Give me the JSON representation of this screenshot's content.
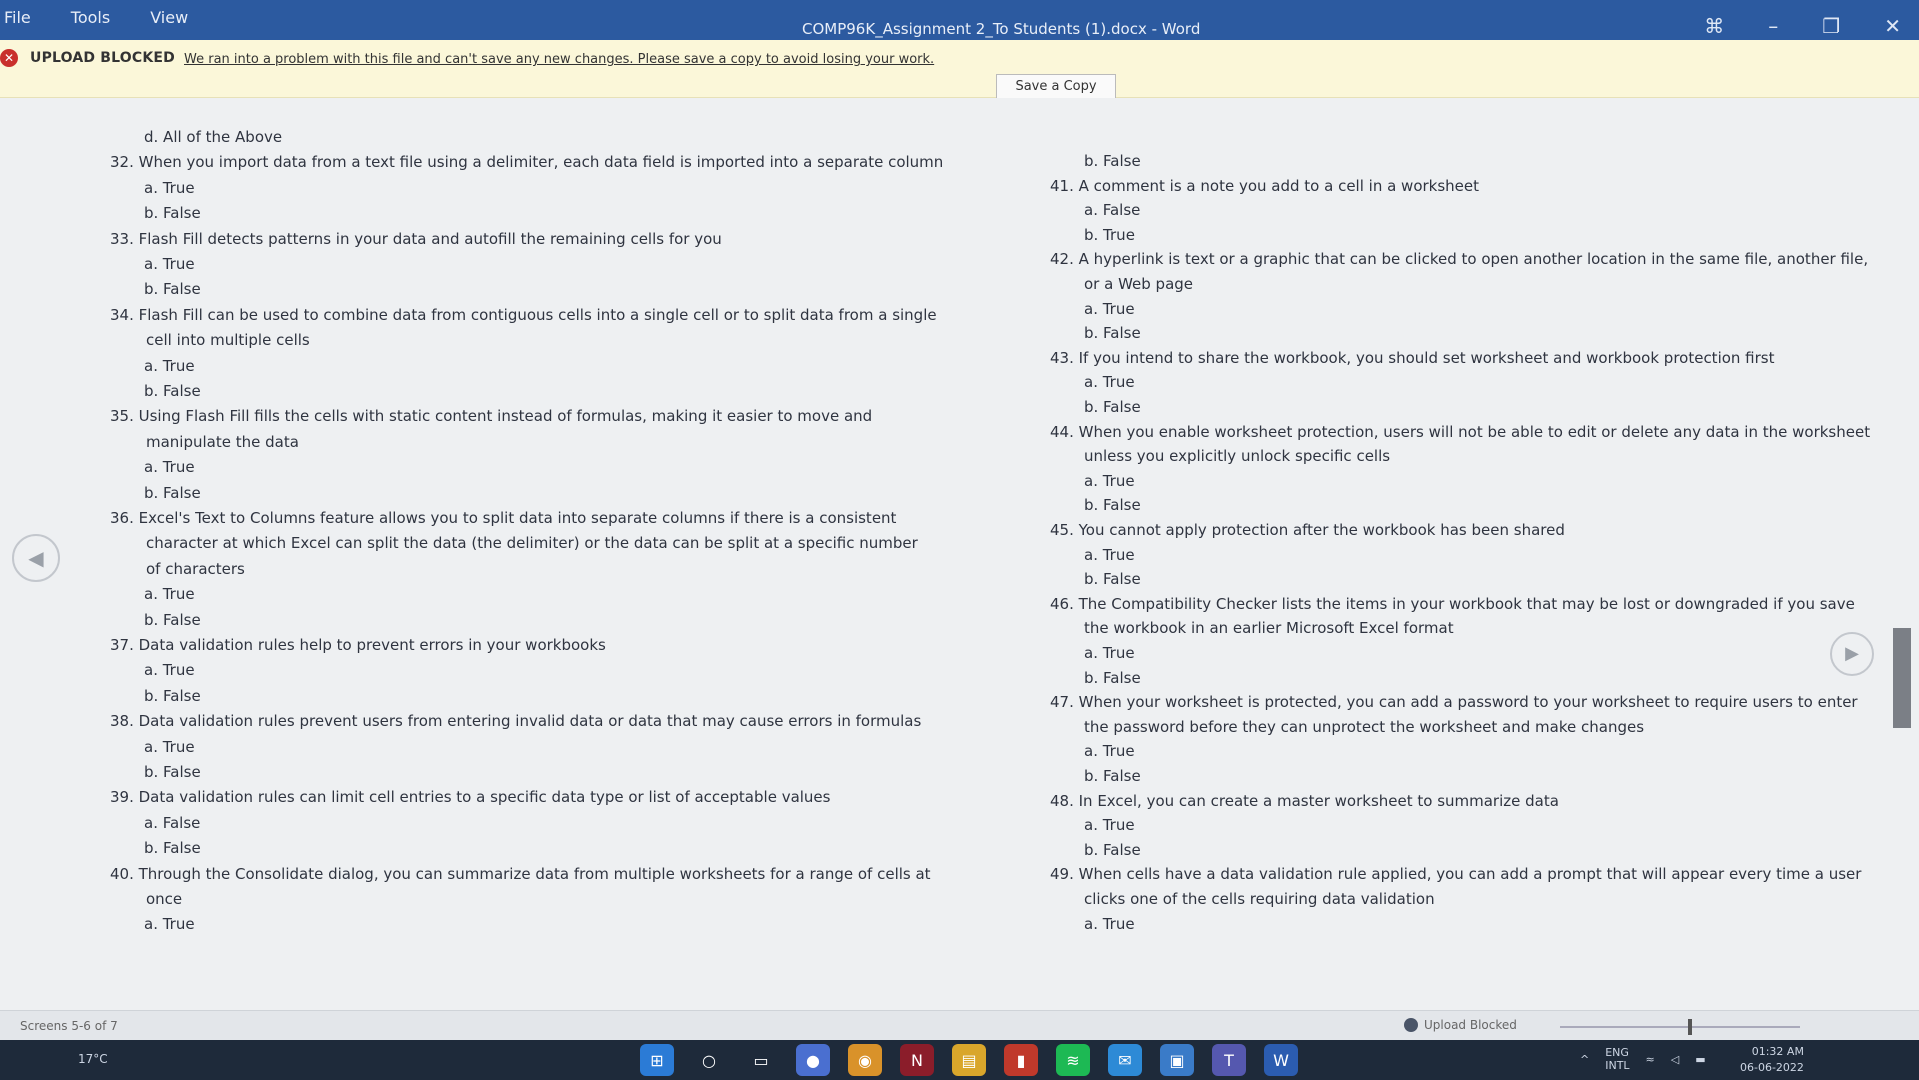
{
  "menu": [
    "File",
    "Tools",
    "View"
  ],
  "window": {
    "title": "COMP96K_Assignment 2_To Students (1).docx - Word"
  },
  "message_bar": {
    "title": "UPLOAD BLOCKED",
    "text": "We ran into a problem with this file and can't save any new changes. Please save a copy to avoid losing your work.",
    "button": "Save a Copy"
  },
  "left_column": [
    {
      "text": "d. All of the Above",
      "indent": 1
    },
    {
      "text": "32. When you import data from a text file using a delimiter, each data field is imported into a separate column",
      "indent": 0
    },
    {
      "text": "a. True",
      "indent": 1
    },
    {
      "text": "b. False",
      "indent": 1
    },
    {
      "text": "33. Flash Fill detects patterns in your data and autofill the remaining cells for you",
      "indent": 0
    },
    {
      "text": "a. True",
      "indent": 1
    },
    {
      "text": "b. False",
      "indent": 1
    },
    {
      "text": "34. Flash Fill can be used to combine data from contiguous cells into a single cell or to split data from a single",
      "indent": 0
    },
    {
      "text": "cell into multiple cells",
      "indent": 2
    },
    {
      "text": "a. True",
      "indent": 1
    },
    {
      "text": "b. False",
      "indent": 1
    },
    {
      "text": "35. Using Flash Fill fills the cells with static content instead of formulas, making it easier to move and",
      "indent": 0
    },
    {
      "text": "manipulate the data",
      "indent": 2
    },
    {
      "text": "a. True",
      "indent": 1
    },
    {
      "text": "b. False",
      "indent": 1
    },
    {
      "text": "36. Excel's Text to Columns feature allows you to split data into separate columns if there is a consistent",
      "indent": 0
    },
    {
      "text": "character at which Excel can split the data (the delimiter) or the data can be split at a specific number",
      "indent": 2
    },
    {
      "text": "of characters",
      "indent": 2
    },
    {
      "text": "a. True",
      "indent": 1
    },
    {
      "text": "b. False",
      "indent": 1
    },
    {
      "text": "37. Data validation rules help to prevent errors in your workbooks",
      "indent": 0
    },
    {
      "text": "a. True",
      "indent": 1
    },
    {
      "text": "b. False",
      "indent": 1
    },
    {
      "text": "38. Data validation rules prevent users from entering invalid data or data that may cause errors in formulas",
      "indent": 0
    },
    {
      "text": "a. True",
      "indent": 1
    },
    {
      "text": "b. False",
      "indent": 1
    },
    {
      "text": "39. Data validation rules can limit cell entries to a specific data type or list of acceptable values",
      "indent": 0
    },
    {
      "text": "a. False",
      "indent": 1
    },
    {
      "text": "b. False",
      "indent": 1
    },
    {
      "text": "40. Through the Consolidate dialog, you can summarize data from multiple worksheets for a range of cells at",
      "indent": 0
    },
    {
      "text": "once",
      "indent": 2
    },
    {
      "text": "a. True",
      "indent": 1
    }
  ],
  "right_column": [
    {
      "text": "b. False",
      "indent": 1
    },
    {
      "text": "41. A comment is a note you add to a cell in a worksheet",
      "indent": 0
    },
    {
      "text": "a. False",
      "indent": 1
    },
    {
      "text": "b. True",
      "indent": 1
    },
    {
      "text": "42. A hyperlink is text or a graphic that can be clicked to open another location in the same file, another file,",
      "indent": 0
    },
    {
      "text": "or a Web page",
      "indent": 2
    },
    {
      "text": "a. True",
      "indent": 1
    },
    {
      "text": "b. False",
      "indent": 1
    },
    {
      "text": "43. If you intend to share the workbook, you should set worksheet and workbook protection first",
      "indent": 0
    },
    {
      "text": "a. True",
      "indent": 1
    },
    {
      "text": "b. False",
      "indent": 1
    },
    {
      "text": "44. When you enable worksheet protection, users will not be able to edit or delete any data in the worksheet",
      "indent": 0
    },
    {
      "text": "unless you explicitly unlock specific cells",
      "indent": 2
    },
    {
      "text": "a. True",
      "indent": 1
    },
    {
      "text": "b. False",
      "indent": 1
    },
    {
      "text": "45. You cannot apply protection after the workbook has been shared",
      "indent": 0
    },
    {
      "text": "a. True",
      "indent": 1
    },
    {
      "text": "b. False",
      "indent": 1
    },
    {
      "text": "46. The Compatibility Checker lists the items in your workbook that may be lost or downgraded if you save",
      "indent": 0
    },
    {
      "text": "the workbook in an earlier Microsoft Excel format",
      "indent": 2
    },
    {
      "text": "a. True",
      "indent": 1
    },
    {
      "text": "b. False",
      "indent": 1
    },
    {
      "text": "47. When your worksheet is protected, you can add a password to your worksheet to require users to enter",
      "indent": 0
    },
    {
      "text": "the password before they can unprotect the worksheet and make changes",
      "indent": 2
    },
    {
      "text": "a. True",
      "indent": 1
    },
    {
      "text": "b. False",
      "indent": 1
    },
    {
      "text": "48. In Excel, you can create a master worksheet to summarize data",
      "indent": 0
    },
    {
      "text": "a. True",
      "indent": 1
    },
    {
      "text": "b. False",
      "indent": 1
    },
    {
      "text": "49. When cells have a data validation rule applied, you can add a prompt that will appear every time a user",
      "indent": 0
    },
    {
      "text": "clicks one of the cells requiring data validation",
      "indent": 2
    },
    {
      "text": "a. True",
      "indent": 1
    }
  ],
  "status": {
    "screens": "Screens 5-6 of 7",
    "upload": "Upload Blocked"
  },
  "taskbar": {
    "temperature": "17°C",
    "lang1": "ENG",
    "lang2": "INTL",
    "time": "01:32 AM",
    "date": "06-06-2022"
  },
  "colors": {
    "title_bar": "#2c5aa0",
    "message_bar": "#fbf7d9",
    "alert": "#c9302c"
  }
}
